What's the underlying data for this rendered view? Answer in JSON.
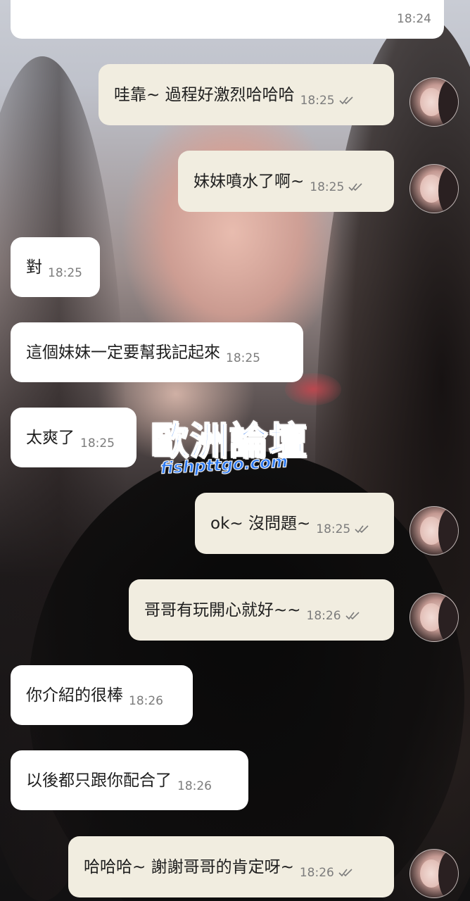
{
  "conversation": {
    "messages": [
      {
        "direction": "in",
        "text": "",
        "time": "18:24",
        "read": false
      },
      {
        "direction": "out",
        "text": "哇靠~ 過程好激烈哈哈哈",
        "time": "18:25",
        "read": true
      },
      {
        "direction": "out",
        "text": "妹妹噴水了啊~",
        "time": "18:25",
        "read": true
      },
      {
        "direction": "in",
        "text": "對",
        "time": "18:25",
        "read": false
      },
      {
        "direction": "in",
        "text": "這個妹妹一定要幫我記起來",
        "time": "18:25",
        "read": false
      },
      {
        "direction": "in",
        "text": "太爽了",
        "time": "18:25",
        "read": false
      },
      {
        "direction": "out",
        "text": "ok~ 沒問題~",
        "time": "18:25",
        "read": true
      },
      {
        "direction": "out",
        "text": "哥哥有玩開心就好~~",
        "time": "18:26",
        "read": true
      },
      {
        "direction": "in",
        "text": "你介紹的很棒",
        "time": "18:26",
        "read": false
      },
      {
        "direction": "in",
        "text": "以後都只跟你配合了",
        "time": "18:26",
        "read": false
      },
      {
        "direction": "out",
        "text": "哈哈哈~ 謝謝哥哥的肯定呀~",
        "time": "18:26",
        "read": true
      }
    ]
  },
  "watermark": {
    "title": "歐洲論壇",
    "url": "fishpttgo.com"
  },
  "icons": {
    "read_receipt": "double-check-icon",
    "avatar": "contact-avatar"
  },
  "colors": {
    "incoming_bubble": "#ffffff",
    "outgoing_bubble": "#f1ede0",
    "watermark": "#2f7af0",
    "time_text": "#7c7c7c"
  }
}
